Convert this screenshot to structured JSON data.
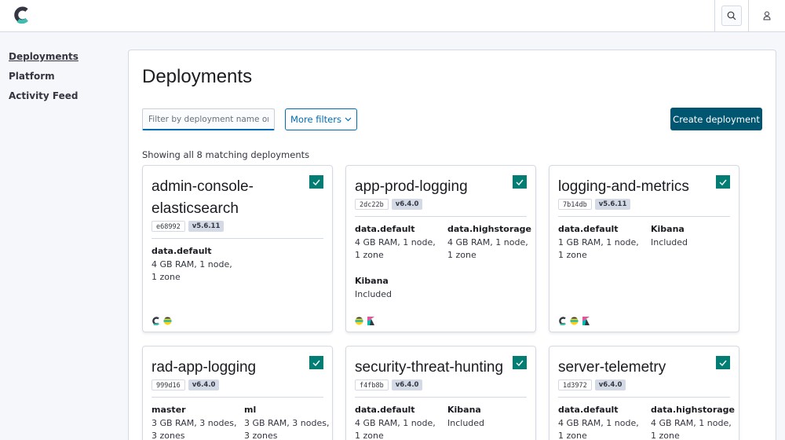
{
  "sidebar": {
    "items": [
      {
        "label": "Deployments",
        "active": true
      },
      {
        "label": "Platform"
      },
      {
        "label": "Activity Feed"
      }
    ]
  },
  "page": {
    "title": "Deployments",
    "search_placeholder": "Filter by deployment name or id .",
    "more_filters_label": "More filters",
    "create_label": "Create deployment",
    "showing_text": "Showing all 8 matching deployments"
  },
  "cards": [
    {
      "name": "admin-console-elasticsearch",
      "id": "e68992",
      "version": "v5.6.11",
      "topology": [
        {
          "label": "data.default",
          "value": "4 GB RAM, 1 node, 1 zone"
        }
      ],
      "icons": [
        "elastic-cloud-icon",
        "elasticsearch-icon"
      ]
    },
    {
      "name": "app-prod-logging",
      "id": "2dc22b",
      "version": "v6.4.0",
      "topology": [
        {
          "label": "data.default",
          "value": "4 GB RAM, 1 node, 1 zone"
        },
        {
          "label": "data.highstorage",
          "value": "4 GB RAM, 1 node, 1 zone"
        },
        {
          "label": "Kibana",
          "value": "Included"
        }
      ],
      "icons": [
        "elasticsearch-icon",
        "kibana-icon"
      ]
    },
    {
      "name": "logging-and-metrics",
      "id": "7b14db",
      "version": "v5.6.11",
      "topology": [
        {
          "label": "data.default",
          "value": "1 GB RAM, 1 node, 1 zone"
        },
        {
          "label": "Kibana",
          "value": "Included"
        }
      ],
      "icons": [
        "elastic-cloud-icon",
        "elasticsearch-icon",
        "kibana-icon"
      ]
    },
    {
      "name": "rad-app-logging",
      "id": "999d16",
      "version": "v6.4.0",
      "topology": [
        {
          "label": "master",
          "value": "3 GB RAM, 3 nodes, 3 zones"
        },
        {
          "label": "ml",
          "value": "3 GB RAM, 3 nodes, 3 zones"
        }
      ]
    },
    {
      "name": "security-threat-hunting",
      "id": "f4fb8b",
      "version": "v6.4.0",
      "topology": [
        {
          "label": "data.default",
          "value": "4 GB RAM, 1 node, 1 zone"
        },
        {
          "label": "Kibana",
          "value": "Included"
        }
      ]
    },
    {
      "name": "server-telemetry",
      "id": "1d3972",
      "version": "v6.4.0",
      "topology": [
        {
          "label": "data.default",
          "value": "4 GB RAM, 1 node, 1 zone"
        },
        {
          "label": "data.highstorage",
          "value": "4 GB RAM, 1 node, 1 zone"
        }
      ]
    }
  ],
  "colors": {
    "accent": "#006bb4",
    "primary_button": "#005571",
    "check": "#017d73"
  }
}
